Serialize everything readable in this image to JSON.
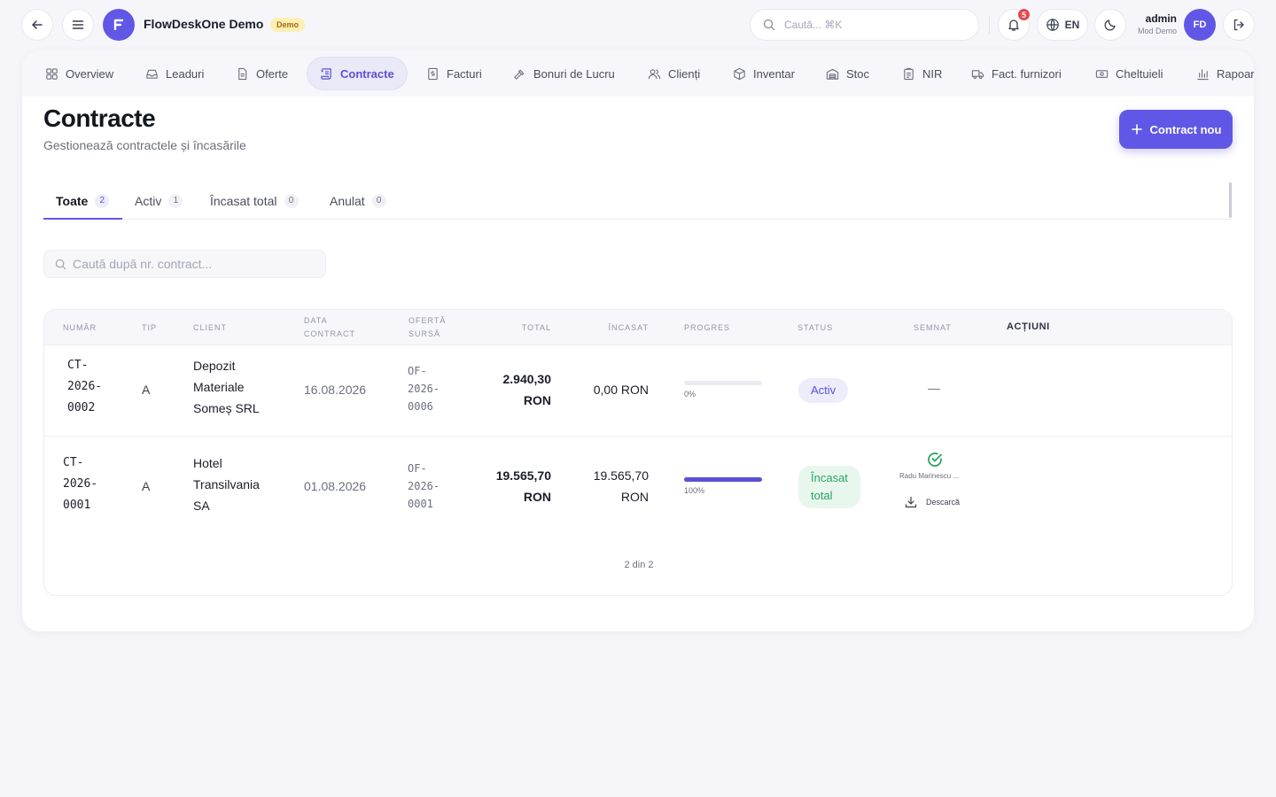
{
  "topbar": {
    "app_title": "FlowDeskOne Demo",
    "demo_badge": "Demo",
    "search_placeholder": "Caută... ⌘K",
    "notifications_count": "5",
    "language": "EN",
    "user_name": "admin",
    "user_role": "Mod Demo",
    "avatar_initials": "FD"
  },
  "nav": {
    "items": [
      {
        "label": "Overview"
      },
      {
        "label": "Leaduri"
      },
      {
        "label": "Oferte"
      },
      {
        "label": "Contracte"
      },
      {
        "label": "Facturi"
      },
      {
        "label": "Bonuri de Lucru"
      },
      {
        "label": "Clienți"
      },
      {
        "label": "Inventar"
      },
      {
        "label": "Stoc"
      },
      {
        "label": "NIR"
      },
      {
        "label": "Fact. furnizori"
      },
      {
        "label": "Cheltuieli"
      },
      {
        "label": "Rapoarte"
      }
    ],
    "active_index": 3
  },
  "page": {
    "title": "Contracte",
    "subtitle": "Gestionează contractele și încasările",
    "new_button": "Contract nou"
  },
  "tabs": [
    {
      "label": "Toate",
      "count": "2"
    },
    {
      "label": "Activ",
      "count": "1"
    },
    {
      "label": "Încasat total",
      "count": "0"
    },
    {
      "label": "Anulat",
      "count": "0"
    }
  ],
  "search": {
    "placeholder": "Caută după nr. contract..."
  },
  "table": {
    "headers": {
      "number": "NUMĂR",
      "type": "TIP",
      "client": "CLIENT",
      "date_1": "DATA",
      "date_2": "CONTRACT",
      "offer_1": "OFERTĂ",
      "offer_2": "SURSĂ",
      "total": "TOTAL",
      "paid": "ÎNCASAT",
      "progress": "PROGRES",
      "status": "STATUS",
      "signed": "SEMNAT",
      "actions": "ACȚIUNI"
    },
    "rows": [
      {
        "number": [
          "CT-",
          "2026-",
          "0002"
        ],
        "type": "A",
        "client": [
          "Depozit",
          "Materiale",
          "Someș SRL"
        ],
        "date": "16.08.2026",
        "offer": [
          "OF-",
          "2026-",
          "0006"
        ],
        "total": [
          "2.940,30",
          "RON"
        ],
        "paid": [
          "0,00 RON"
        ],
        "progress": 0,
        "progress_label": "0%",
        "status": [
          "Activ"
        ],
        "signed": "—"
      },
      {
        "number": [
          "CT-",
          "2026-",
          "0001"
        ],
        "type": "A",
        "client": [
          "Hotel",
          "Transilvania",
          "SA"
        ],
        "date": "01.08.2026",
        "offer": [
          "OF-",
          "2026-",
          "0001"
        ],
        "total": [
          "19.565,70",
          "RON"
        ],
        "paid": [
          "19.565,70",
          "RON"
        ],
        "progress": 100,
        "progress_label": "100%",
        "status": [
          "Încasat",
          "total"
        ],
        "signer": "Radu Marinescu ...",
        "download": "Descarcă"
      }
    ],
    "footer": "2 din 2"
  },
  "colors": {
    "accent": "#6157e6",
    "success": "#2aa564",
    "danger": "#e5484d"
  }
}
